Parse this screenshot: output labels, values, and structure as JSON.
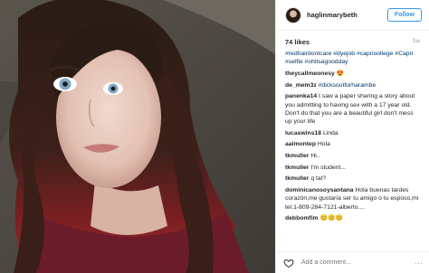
{
  "post": {
    "username": "haglinmarybeth",
    "follow_label": "Follow",
    "likes": "74 likes",
    "time": "1w",
    "caption_tags": "#redhairdontcare #dyejob #caprioollege #Capri #selfie #ohitsagoodday"
  },
  "comments": [
    {
      "user": "theycallmeonesy",
      "text": "😍"
    },
    {
      "user": "de_mem3z",
      "text": "#dicksoutforharambe"
    },
    {
      "user": "panenka14",
      "text": "I saw a paper sharing a story about you admitting to having sex with a 17 year old. Don't do that you are a beautiful girl don't mess up your life"
    },
    {
      "user": "lucaswins18",
      "text": "Linda"
    },
    {
      "user": "aalmontep",
      "text": "Hola"
    },
    {
      "user": "tkmuller",
      "text": "Hi.."
    },
    {
      "user": "tkmuller",
      "text": "I'm student..."
    },
    {
      "user": "tkmuller",
      "text": "q tal?"
    },
    {
      "user": "dominicanosoysantana",
      "text": "Hola buenas tardes corazón,me gustaría ser tu amigo o tu esposo,mi tel.1-809-284-7121-alberto...."
    },
    {
      "user": "debbomfim",
      "text": "😊😊😊"
    }
  ],
  "add_comment": {
    "placeholder": "Add a comment...",
    "more": "···"
  },
  "colors": {
    "accent": "#3897f0",
    "hashtag": "#003569"
  },
  "icons": {
    "like": "heart-icon",
    "options": "more-options-icon"
  }
}
